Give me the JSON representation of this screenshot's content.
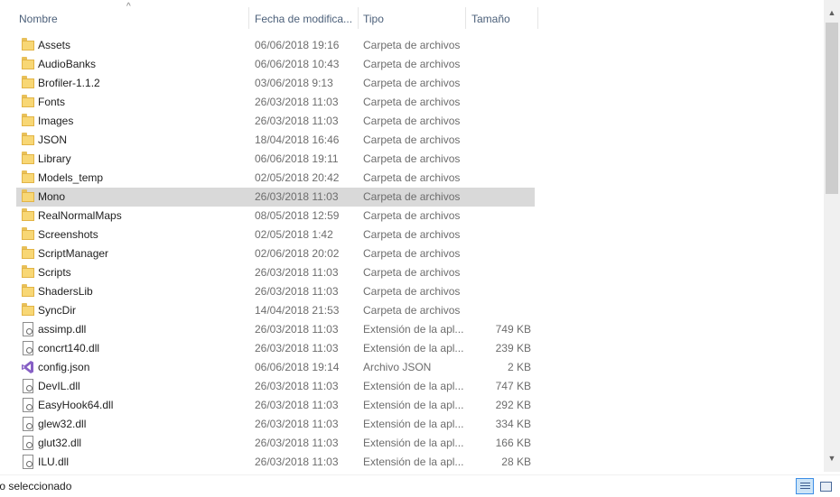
{
  "columns": {
    "name": "Nombre",
    "date": "Fecha de modifica...",
    "type": "Tipo",
    "size": "Tamaño"
  },
  "sort_indicator": "^",
  "rows": [
    {
      "name": "Assets",
      "date": "06/06/2018 19:16",
      "type": "Carpeta de archivos",
      "size": "",
      "icon": "folder-icon"
    },
    {
      "name": "AudioBanks",
      "date": "06/06/2018 10:43",
      "type": "Carpeta de archivos",
      "size": "",
      "icon": "folder-icon"
    },
    {
      "name": "Brofiler-1.1.2",
      "date": "03/06/2018 9:13",
      "type": "Carpeta de archivos",
      "size": "",
      "icon": "folder-icon"
    },
    {
      "name": "Fonts",
      "date": "26/03/2018 11:03",
      "type": "Carpeta de archivos",
      "size": "",
      "icon": "folder-icon"
    },
    {
      "name": "Images",
      "date": "26/03/2018 11:03",
      "type": "Carpeta de archivos",
      "size": "",
      "icon": "folder-icon"
    },
    {
      "name": "JSON",
      "date": "18/04/2018 16:46",
      "type": "Carpeta de archivos",
      "size": "",
      "icon": "folder-icon"
    },
    {
      "name": "Library",
      "date": "06/06/2018 19:11",
      "type": "Carpeta de archivos",
      "size": "",
      "icon": "folder-icon"
    },
    {
      "name": "Models_temp",
      "date": "02/05/2018 20:42",
      "type": "Carpeta de archivos",
      "size": "",
      "icon": "folder-icon"
    },
    {
      "name": "Mono",
      "date": "26/03/2018 11:03",
      "type": "Carpeta de archivos",
      "size": "",
      "icon": "folder-icon",
      "selected": true
    },
    {
      "name": "RealNormalMaps",
      "date": "08/05/2018 12:59",
      "type": "Carpeta de archivos",
      "size": "",
      "icon": "folder-icon"
    },
    {
      "name": "Screenshots",
      "date": "02/05/2018 1:42",
      "type": "Carpeta de archivos",
      "size": "",
      "icon": "folder-icon"
    },
    {
      "name": "ScriptManager",
      "date": "02/06/2018 20:02",
      "type": "Carpeta de archivos",
      "size": "",
      "icon": "folder-icon"
    },
    {
      "name": "Scripts",
      "date": "26/03/2018 11:03",
      "type": "Carpeta de archivos",
      "size": "",
      "icon": "folder-icon"
    },
    {
      "name": "ShadersLib",
      "date": "26/03/2018 11:03",
      "type": "Carpeta de archivos",
      "size": "",
      "icon": "folder-icon"
    },
    {
      "name": "SyncDir",
      "date": "14/04/2018 21:53",
      "type": "Carpeta de archivos",
      "size": "",
      "icon": "folder-icon"
    },
    {
      "name": "assimp.dll",
      "date": "26/03/2018 11:03",
      "type": "Extensión de la apl...",
      "size": "749 KB",
      "icon": "dll-file-icon"
    },
    {
      "name": "concrt140.dll",
      "date": "26/03/2018 11:03",
      "type": "Extensión de la apl...",
      "size": "239 KB",
      "icon": "dll-file-icon"
    },
    {
      "name": "config.json",
      "date": "06/06/2018 19:14",
      "type": "Archivo JSON",
      "size": "2 KB",
      "icon": "visual-studio-icon"
    },
    {
      "name": "DevIL.dll",
      "date": "26/03/2018 11:03",
      "type": "Extensión de la apl...",
      "size": "747 KB",
      "icon": "dll-file-icon"
    },
    {
      "name": "EasyHook64.dll",
      "date": "26/03/2018 11:03",
      "type": "Extensión de la apl...",
      "size": "292 KB",
      "icon": "dll-file-icon"
    },
    {
      "name": "glew32.dll",
      "date": "26/03/2018 11:03",
      "type": "Extensión de la apl...",
      "size": "334 KB",
      "icon": "dll-file-icon"
    },
    {
      "name": "glut32.dll",
      "date": "26/03/2018 11:03",
      "type": "Extensión de la apl...",
      "size": "166 KB",
      "icon": "dll-file-icon"
    },
    {
      "name": "ILU.dll",
      "date": "26/03/2018 11:03",
      "type": "Extensión de la apl...",
      "size": "28 KB",
      "icon": "dll-file-icon"
    }
  ],
  "status": {
    "text": "to seleccionado"
  },
  "scrollbar": {
    "up_arrow": "▲",
    "down_arrow": "▼"
  },
  "colors": {
    "selected_row": "#d9d9d9",
    "header_text": "#4c607a",
    "folder": "#f8d775",
    "visual_studio": "#865fc5"
  }
}
